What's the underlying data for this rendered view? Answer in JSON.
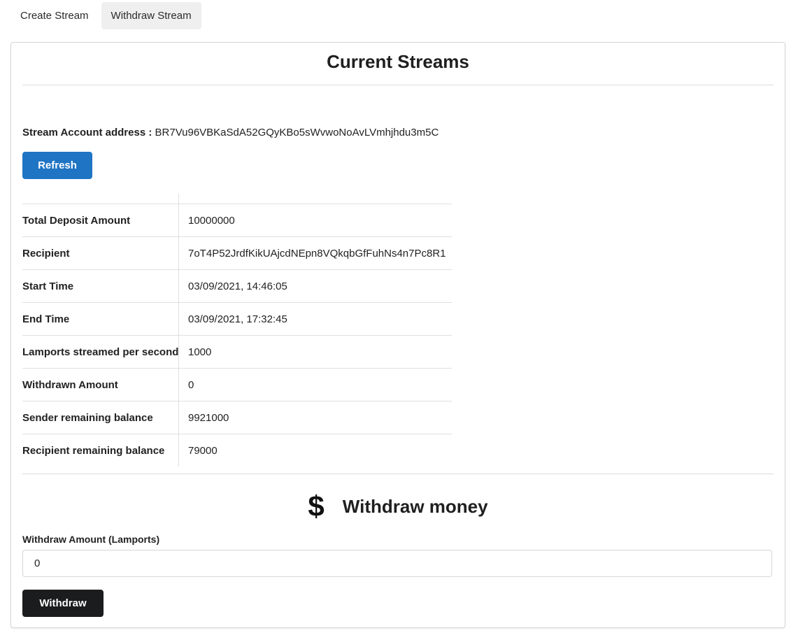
{
  "tabs": [
    {
      "label": "Create Stream",
      "active": false
    },
    {
      "label": "Withdraw Stream",
      "active": true
    }
  ],
  "current_streams": {
    "title": "Current Streams",
    "address_label": "Stream Account address :",
    "address_value": "BR7Vu96VBKaSdA52GQyKBo5sWvwoNoAvLVmhjhdu3m5C",
    "refresh_label": "Refresh",
    "rows": [
      {
        "key": "Total Deposit Amount",
        "value": "10000000"
      },
      {
        "key": "Recipient",
        "value": "7oT4P52JrdfKikUAjcdNEpn8VQkqbGfFuhNs4n7Pc8R1"
      },
      {
        "key": "Start Time",
        "value": "03/09/2021, 14:46:05"
      },
      {
        "key": "End Time",
        "value": "03/09/2021, 17:32:45"
      },
      {
        "key": "Lamports streamed per second",
        "value": "1000"
      },
      {
        "key": "Withdrawn Amount",
        "value": "0"
      },
      {
        "key": "Sender remaining balance",
        "value": "9921000"
      },
      {
        "key": "Recipient remaining balance",
        "value": "79000"
      }
    ]
  },
  "withdraw": {
    "icon": "dollar-icon",
    "icon_glyph": "$",
    "title": "Withdraw money",
    "amount_label": "Withdraw Amount (Lamports)",
    "amount_value": "0",
    "button_label": "Withdraw"
  },
  "colors": {
    "primary": "#1f74c4",
    "dark_button": "#1b1c1d",
    "active_tab_bg": "#efefef"
  }
}
